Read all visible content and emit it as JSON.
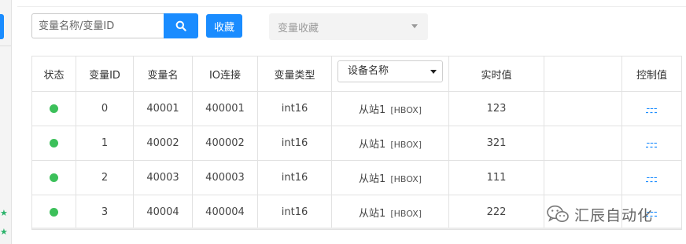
{
  "toolbar": {
    "search_placeholder": "变量名称/变量ID",
    "search_icon": "search-icon",
    "favorite_label": "收藏",
    "favorites_select": "变量收藏"
  },
  "table": {
    "headers": {
      "status": "状态",
      "var_id": "变量ID",
      "var_name": "变量名",
      "io": "IO连接",
      "type": "变量类型",
      "device": "设备名称",
      "realtime": "实时值",
      "blank": "",
      "control": "控制值"
    },
    "rows": [
      {
        "status": "online",
        "id": "0",
        "name": "40001",
        "io": "400001",
        "type": "int16",
        "device": "从站1",
        "device_tag": "[HBOX]",
        "value": "123",
        "control": "---"
      },
      {
        "status": "online",
        "id": "1",
        "name": "40002",
        "io": "400002",
        "type": "int16",
        "device": "从站1",
        "device_tag": "[HBOX]",
        "value": "321",
        "control": "---"
      },
      {
        "status": "online",
        "id": "2",
        "name": "40003",
        "io": "400003",
        "type": "int16",
        "device": "从站1",
        "device_tag": "[HBOX]",
        "value": "111",
        "control": "---"
      },
      {
        "status": "online",
        "id": "3",
        "name": "40004",
        "io": "400004",
        "type": "int16",
        "device": "从站1",
        "device_tag": "[HBOX]",
        "value": "222",
        "control": "---"
      }
    ]
  },
  "colors": {
    "accent": "#1a8cff",
    "status_online": "#3cc05a"
  },
  "watermark": {
    "icon": "wechat-icon",
    "text": "汇辰自动化"
  }
}
